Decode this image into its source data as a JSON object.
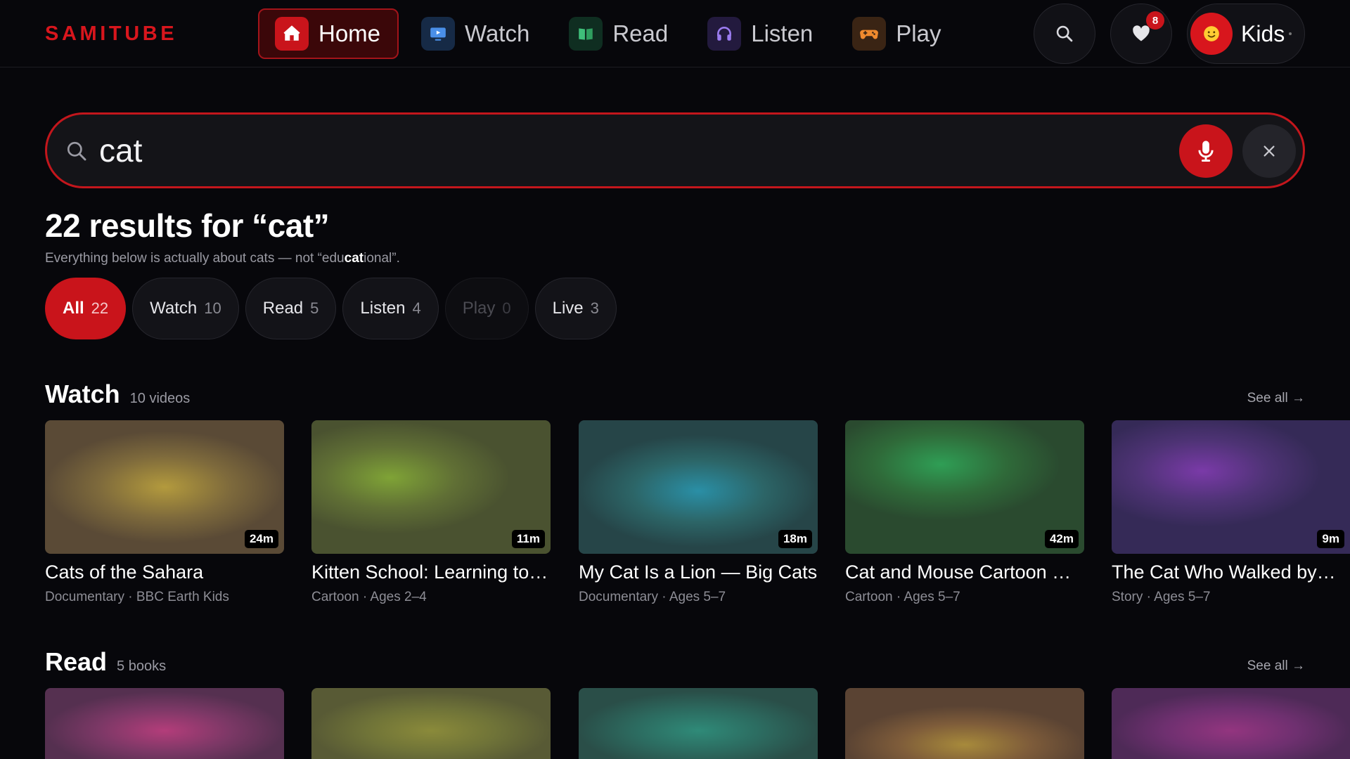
{
  "brand": {
    "logo": "SAMITUBE",
    "accent": "#d8161d"
  },
  "nav": [
    {
      "label": "Home",
      "icon": "home-icon",
      "active": true
    },
    {
      "label": "Watch",
      "icon": "tv-icon",
      "active": false
    },
    {
      "label": "Read",
      "icon": "book-icon",
      "active": false
    },
    {
      "label": "Listen",
      "icon": "headphones-icon",
      "active": false
    },
    {
      "label": "Play",
      "icon": "gamepad-icon",
      "active": false
    }
  ],
  "header": {
    "favorites_badge": "8",
    "profile_name": "Kids",
    "profile_avatar": "smiley-face-icon"
  },
  "search": {
    "query": "cat"
  },
  "results": {
    "title": "22 results for “cat”",
    "subtitle_pre": "Everything below is actually about cats — not “edu",
    "subtitle_bold": "cat",
    "subtitle_post": "ional”."
  },
  "filters": [
    {
      "label": "All",
      "count": "22",
      "active": true,
      "disabled": false
    },
    {
      "label": "Watch",
      "count": "10",
      "active": false,
      "disabled": false
    },
    {
      "label": "Read",
      "count": "5",
      "active": false,
      "disabled": false
    },
    {
      "label": "Listen",
      "count": "4",
      "active": false,
      "disabled": false
    },
    {
      "label": "Play",
      "count": "0",
      "active": false,
      "disabled": true
    },
    {
      "label": "Live",
      "count": "3",
      "active": false,
      "disabled": false
    }
  ],
  "watch": {
    "title": "Watch",
    "count": "10 videos",
    "see_all": "See all →",
    "items": [
      {
        "title": "Cats of the Sahara",
        "meta": "Documentary · BBC Earth Kids",
        "duration": "24m"
      },
      {
        "title": "Kitten School: Learning to Purr",
        "meta": "Cartoon · Ages 2–4",
        "duration": "11m"
      },
      {
        "title": "My Cat Is a Lion — Big Cats",
        "meta": "Documentary · Ages 5–7",
        "duration": "18m"
      },
      {
        "title": "Cat and Mouse Cartoon Classics",
        "meta": "Cartoon · Ages 5–7",
        "duration": "42m"
      },
      {
        "title": "The Cat Who Walked by Himself",
        "meta": "Story · Ages 5–7",
        "duration": "9m"
      }
    ]
  },
  "read": {
    "title": "Read",
    "count": "5 books",
    "see_all": "See all →"
  }
}
